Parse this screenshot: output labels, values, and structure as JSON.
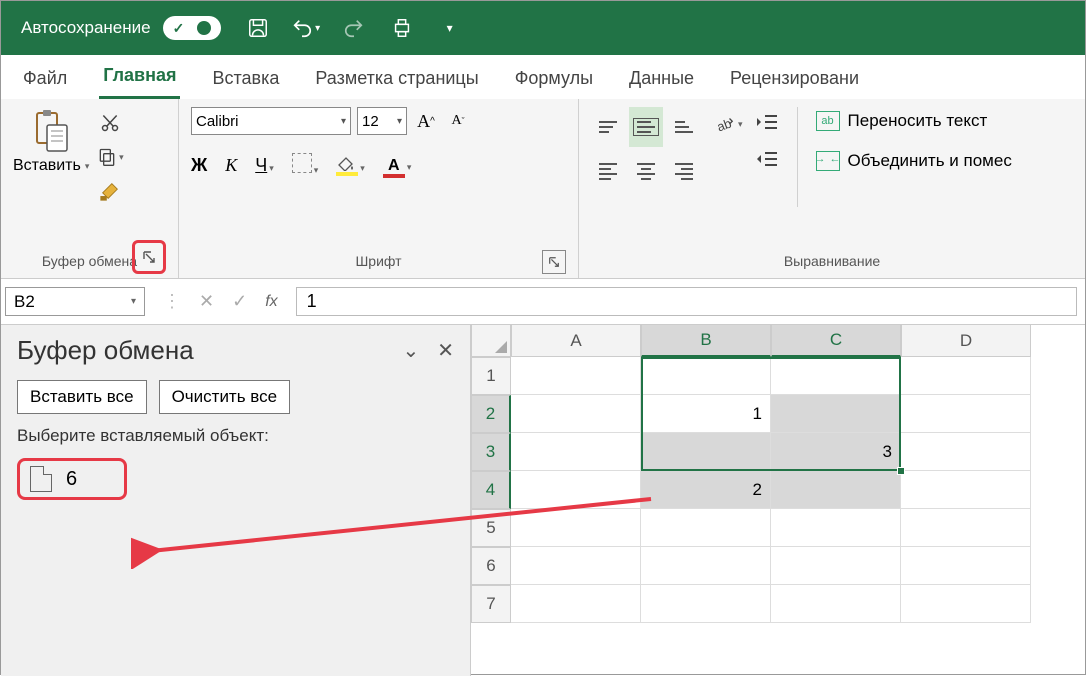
{
  "titlebar": {
    "autosave_label": "Автосохранение"
  },
  "tabs": {
    "file": "Файл",
    "home": "Главная",
    "insert": "Вставка",
    "layout": "Разметка страницы",
    "formulas": "Формулы",
    "data": "Данные",
    "review": "Рецензировани"
  },
  "ribbon": {
    "clipboard": {
      "label": "Буфер обмена",
      "paste": "Вставить"
    },
    "font": {
      "label": "Шрифт",
      "name": "Calibri",
      "size": "12",
      "bold": "Ж",
      "italic": "К",
      "underline": "Ч",
      "font_color_letter": "А"
    },
    "alignment": {
      "label": "Выравнивание",
      "wrap": "Переносить текст",
      "merge": "Объединить и помес"
    }
  },
  "formula_bar": {
    "cell_ref": "B2",
    "fx": "fx",
    "value": "1"
  },
  "clipboard_pane": {
    "title": "Буфер обмена",
    "paste_all": "Вставить все",
    "clear_all": "Очистить все",
    "hint": "Выберите вставляемый объект:",
    "item_value": "6"
  },
  "sheet": {
    "columns": [
      "A",
      "B",
      "C",
      "D"
    ],
    "rows": [
      "1",
      "2",
      "3",
      "4",
      "5",
      "6",
      "7"
    ],
    "cells": {
      "B2": "1",
      "C3": "3",
      "B4": "2"
    }
  }
}
